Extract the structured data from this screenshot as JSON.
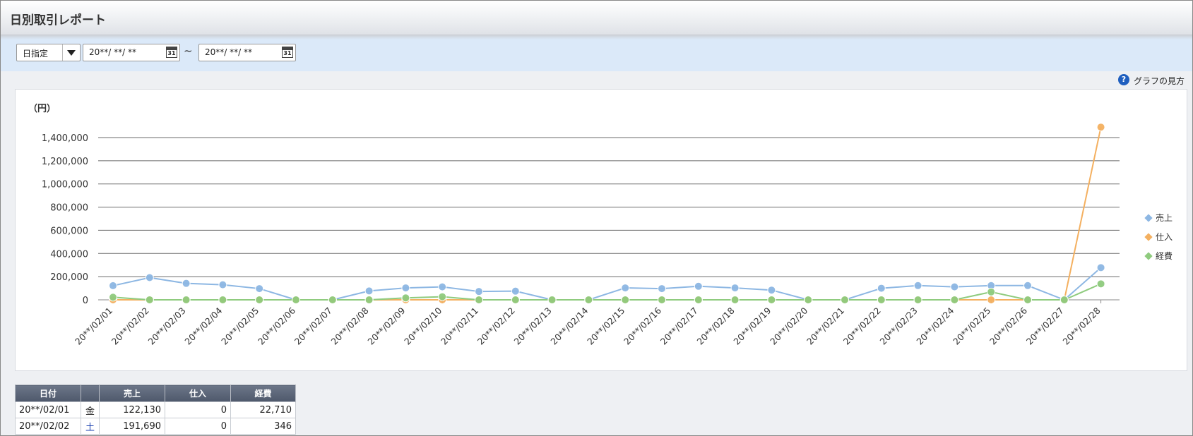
{
  "page": {
    "title": "日別取引レポート"
  },
  "filter": {
    "mode_label": "日指定",
    "date_from": "20**/ **/ **",
    "tilde": "~",
    "date_to": "20**/ **/ **",
    "calendar_icon": "calendar-icon",
    "calendar_number": "31"
  },
  "help": {
    "label": "グラフの見方",
    "icon": "help-icon",
    "icon_glyph": "?"
  },
  "chart_data": {
    "type": "line",
    "unit_label": "（円）",
    "categories": [
      "20**/02/01",
      "20**/02/02",
      "20**/02/03",
      "20**/02/04",
      "20**/02/05",
      "20**/02/06",
      "20**/02/07",
      "20**/02/08",
      "20**/02/09",
      "20**/02/10",
      "20**/02/11",
      "20**/02/12",
      "20**/02/13",
      "20**/02/14",
      "20**/02/15",
      "20**/02/16",
      "20**/02/17",
      "20**/02/18",
      "20**/02/19",
      "20**/02/20",
      "20**/02/21",
      "20**/02/22",
      "20**/02/23",
      "20**/02/24",
      "20**/02/25",
      "20**/02/26",
      "20**/02/27",
      "20**/02/28"
    ],
    "yticks": [
      0,
      200000,
      400000,
      600000,
      800000,
      1000000,
      1200000,
      1400000
    ],
    "ytick_labels": [
      "0",
      "200,000",
      "400,000",
      "600,000",
      "800,000",
      "1,000,000",
      "1,200,000",
      "1,400,000"
    ],
    "ylim": [
      0,
      1400000
    ],
    "grid": true,
    "legend_position": "right",
    "series": [
      {
        "name": "売上",
        "color": "#8db7e3",
        "values": [
          122130,
          191690,
          142000,
          130000,
          97000,
          0,
          0,
          77000,
          103000,
          112000,
          72000,
          75000,
          0,
          0,
          103000,
          97000,
          117000,
          103000,
          84000,
          0,
          0,
          100000,
          123000,
          112000,
          123000,
          123000,
          0,
          278000
        ]
      },
      {
        "name": "仕入",
        "color": "#f4b060",
        "values": [
          0,
          0,
          0,
          0,
          0,
          0,
          0,
          0,
          0,
          0,
          0,
          0,
          0,
          0,
          0,
          0,
          0,
          0,
          0,
          0,
          0,
          0,
          0,
          0,
          0,
          0,
          0,
          1490000
        ]
      },
      {
        "name": "経費",
        "color": "#8fcb7e",
        "values": [
          22710,
          346,
          0,
          0,
          0,
          0,
          0,
          0,
          17000,
          27000,
          0,
          0,
          0,
          0,
          0,
          0,
          0,
          0,
          0,
          0,
          0,
          0,
          0,
          0,
          68000,
          0,
          0,
          138000
        ]
      }
    ]
  },
  "table": {
    "headers": [
      "日付",
      "",
      "売上",
      "仕入",
      "経費"
    ],
    "rows": [
      {
        "date": "20**/02/01",
        "dow": "金",
        "sales": "122,130",
        "purchase": "0",
        "expense": "22,710"
      },
      {
        "date": "20**/02/02",
        "dow": "土",
        "sales": "191,690",
        "purchase": "0",
        "expense": "346"
      }
    ],
    "saturday_color": "#1a3fb0"
  }
}
